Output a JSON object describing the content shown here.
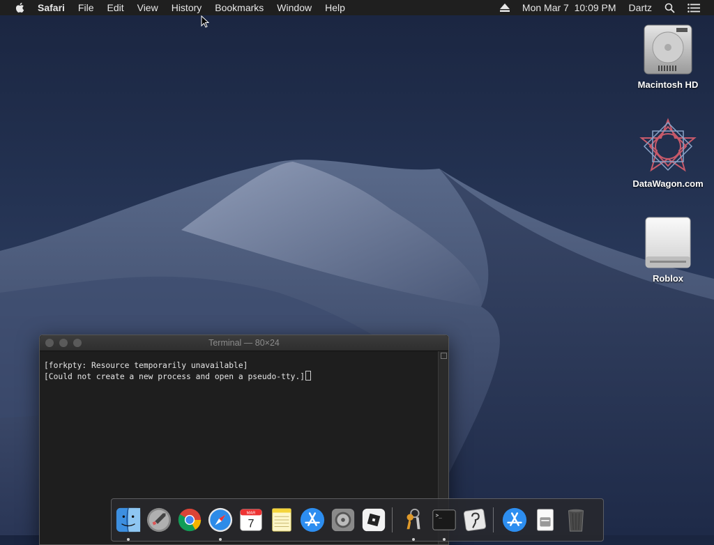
{
  "menubar": {
    "app_name": "Safari",
    "items": [
      "File",
      "Edit",
      "View",
      "History",
      "Bookmarks",
      "Window",
      "Help"
    ],
    "clock": "Mon Mar 7  10:09 PM",
    "user": "Dartz"
  },
  "desktop": {
    "icons": [
      {
        "label": "Macintosh HD",
        "icon": "hard-drive-icon"
      },
      {
        "label": "DataWagon.com",
        "icon": "datawagon-icon"
      },
      {
        "label": "Roblox",
        "icon": "external-drive-icon"
      }
    ]
  },
  "terminal": {
    "title": "Terminal — 80×24",
    "lines": [
      "[forkpty: Resource temporarily unavailable]",
      "[Could not create a new process and open a pseudo-tty.]"
    ]
  },
  "dock": {
    "calendar_month": "MAR",
    "calendar_day": "7"
  }
}
